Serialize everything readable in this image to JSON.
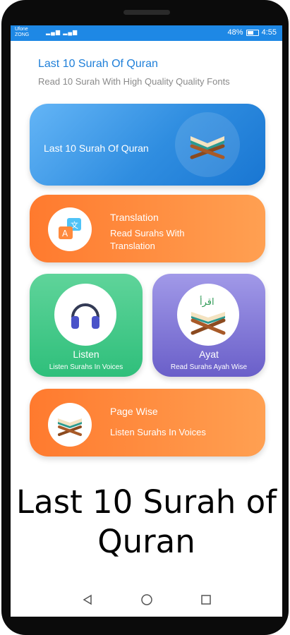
{
  "status_bar": {
    "carrier_top": "Ufone",
    "carrier_bottom": "ZONG",
    "battery": "48%",
    "time": "4:55"
  },
  "header": {
    "title": "Last 10 Surah Of Quran",
    "subtitle": "Read 10 Surah With High Quality Quality Fonts"
  },
  "cards": {
    "quran": {
      "label": "Last 10 Surah Of Quran",
      "icon": "quran-stand-icon"
    },
    "translation": {
      "title": "Translation",
      "subtitle": "Read Surahs With Translation",
      "icon": "translation-icon"
    },
    "listen": {
      "title": "Listen",
      "subtitle": "Listen Surahs In Voices",
      "icon": "headphones-icon"
    },
    "ayat": {
      "title": "Ayat",
      "subtitle": "Read Surahs Ayah Wise",
      "icon": "quran-iqra-icon",
      "arabic": "اقرأ"
    },
    "page_wise": {
      "title": "Page Wise",
      "subtitle": "Listen Surahs In Voices",
      "icon": "quran-book-icon"
    }
  },
  "banner_text": "Last 10 Surah of Quran",
  "colors": {
    "status_bar": "#1e88e5",
    "header_title": "#1e7fd9",
    "orange": "#ff8a3d",
    "green": "#3cc585",
    "purple": "#7d72d6",
    "blue": "#2f8de0"
  }
}
